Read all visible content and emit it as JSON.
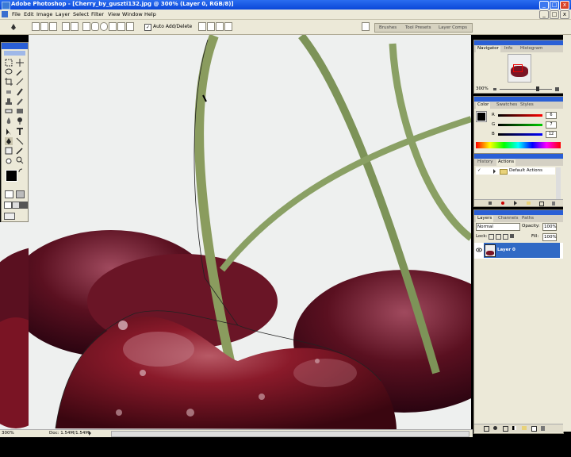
{
  "window": {
    "title": "Adobe Photoshop - [Cherry_by_guszti132.jpg @ 300% (Layer 0, RGB/8)]"
  },
  "menu": [
    "File",
    "Edit",
    "Image",
    "Layer",
    "Select",
    "Filter",
    "View",
    "Window",
    "Help"
  ],
  "options": {
    "auto_add_delete": "Auto Add/Delete"
  },
  "palette_well_tabs": [
    "Brushes",
    "Tool Presets",
    "Layer Comps"
  ],
  "navigator": {
    "tabs": [
      "Navigator",
      "Info",
      "Histogram"
    ],
    "zoom": "300%"
  },
  "color": {
    "tabs": [
      "Color",
      "Swatches",
      "Styles"
    ],
    "channels": [
      {
        "label": "R",
        "value": "6"
      },
      {
        "label": "G",
        "value": "7"
      },
      {
        "label": "B",
        "value": "12"
      }
    ]
  },
  "history": {
    "tabs": [
      "History",
      "Actions"
    ],
    "items": [
      "Default Actions"
    ]
  },
  "layers": {
    "tabs": [
      "Layers",
      "Channels",
      "Paths"
    ],
    "blend_mode": "Normal",
    "opacity_label": "Opacity:",
    "opacity": "100%",
    "lock_label": "Lock:",
    "fill_label": "Fill:",
    "fill": "100%",
    "layer_name": "Layer 0"
  },
  "status": {
    "zoom": "300%",
    "doc": "Doc: 1.54M/1.54M"
  },
  "colors": {
    "accent": "#2a5fd6",
    "chrome": "#ece9d8",
    "selection": "#316ac5"
  },
  "icons": [
    "photoshop-app-icon",
    "minimize-icon",
    "maximize-icon",
    "close-icon",
    "pen-tool-icon",
    "eye-icon",
    "folder-icon",
    "trash-icon",
    "new-layer-icon"
  ]
}
